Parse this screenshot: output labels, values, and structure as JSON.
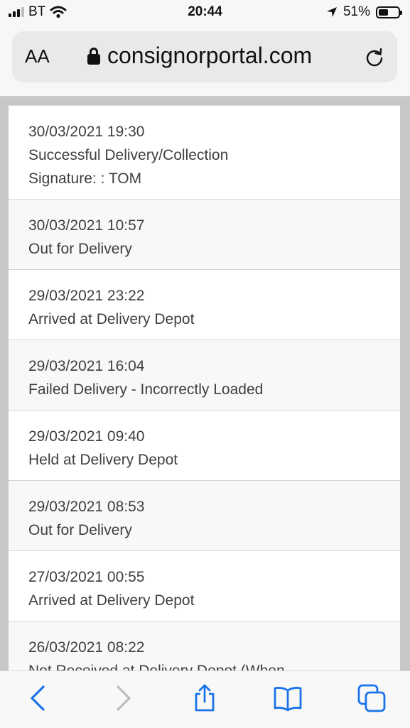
{
  "status_bar": {
    "carrier": "BT",
    "time": "20:44",
    "battery": "51%",
    "battery_level": 0.51,
    "icons": [
      "signal-icon",
      "wifi-icon",
      "location-arrow-icon",
      "battery-icon"
    ]
  },
  "browser": {
    "text_size_label": "AA",
    "domain": "consignorportal.com",
    "icons": [
      "lock-icon",
      "reload-icon"
    ]
  },
  "tracking_events": [
    {
      "datetime": "30/03/2021 19:30",
      "status": "Successful Delivery/Collection",
      "detail": "Signature: : TOM"
    },
    {
      "datetime": "30/03/2021 10:57",
      "status": "Out for Delivery"
    },
    {
      "datetime": "29/03/2021 23:22",
      "status": "Arrived at Delivery Depot"
    },
    {
      "datetime": "29/03/2021 16:04",
      "status": "Failed Delivery - Incorrectly Loaded"
    },
    {
      "datetime": "29/03/2021 09:40",
      "status": "Held at Delivery Depot"
    },
    {
      "datetime": "29/03/2021 08:53",
      "status": "Out for Delivery"
    },
    {
      "datetime": "27/03/2021 00:55",
      "status": "Arrived at Delivery Depot"
    },
    {
      "datetime": "26/03/2021 08:22",
      "status": "Not Received at Delivery Depot (When"
    }
  ],
  "toolbar": {
    "icons": [
      "back-icon",
      "forward-icon",
      "share-icon",
      "bookmarks-icon",
      "tabs-icon"
    ]
  }
}
